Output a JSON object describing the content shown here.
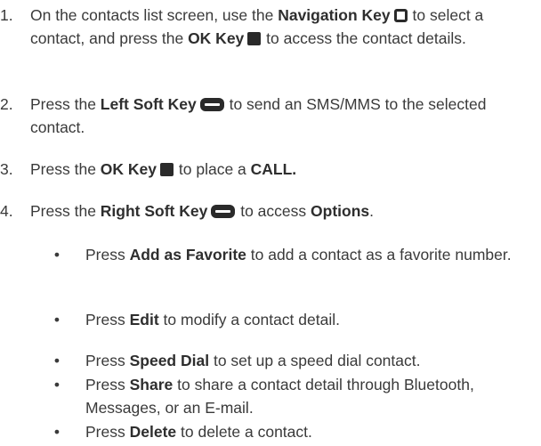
{
  "steps": [
    {
      "number": "1.",
      "parts": [
        "On the contacts list screen, use the ",
        "Navigation Key",
        " to select a contact, and press the ",
        "OK Key",
        " to access the contact details."
      ]
    },
    {
      "number": "2.",
      "parts": [
        "Press the ",
        "Left Soft Key",
        " to send an SMS/MMS to the selected contact."
      ]
    },
    {
      "number": "3.",
      "parts": [
        "Press the ",
        "OK Key",
        " to place a ",
        "CALL."
      ]
    },
    {
      "number": "4.",
      "parts": [
        "Press the ",
        "Right Soft Key",
        " to access ",
        "Options",
        "."
      ]
    }
  ],
  "options": [
    {
      "bullet": "•",
      "pre": "Press ",
      "term": "Add as Favorite",
      "post": " to add a contact as a favorite number."
    },
    {
      "bullet": "•",
      "pre": "Press ",
      "term": "Edit",
      "post": " to modify a contact detail."
    },
    {
      "bullet": "•",
      "pre": "Press ",
      "term": "Speed Dial",
      "post": " to set up a speed dial contact."
    },
    {
      "bullet": "•",
      "pre": "Press ",
      "term": "Share",
      "post": " to share a contact detail through Bluetooth, Messages, or an E-mail."
    },
    {
      "bullet": "•",
      "pre": "Press ",
      "term": "Delete",
      "post": " to delete a contact."
    }
  ],
  "icons": {
    "navigation_key": "navigation-key-icon",
    "ok_key": "ok-key-icon",
    "soft_key": "soft-key-icon"
  }
}
